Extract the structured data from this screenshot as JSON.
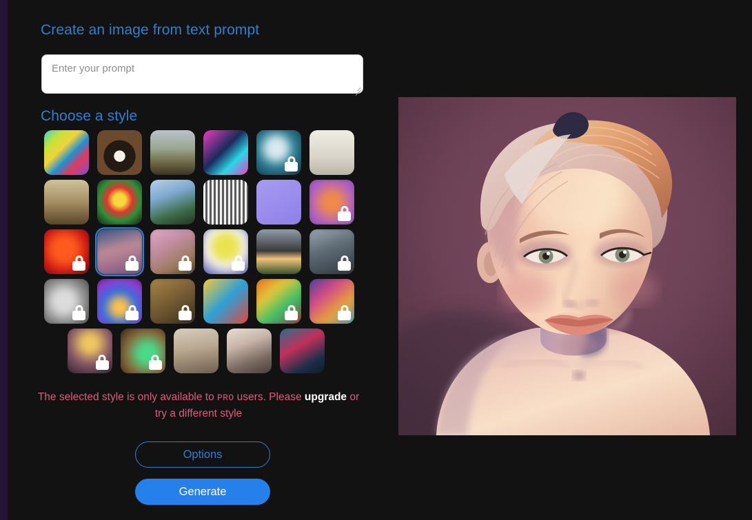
{
  "page": {
    "background": "#121212",
    "left_rail_color": "#251437",
    "accent": "#2f7fd1",
    "generate_color": "#2680eb",
    "error_color": "#e05a7e"
  },
  "headings": {
    "create": "Create an image from text prompt",
    "choose_style": "Choose a style"
  },
  "prompt": {
    "value": "",
    "placeholder": "Enter your prompt"
  },
  "error": {
    "part1": "The selected style is only available to ",
    "pro": "PRO",
    "part2": " users. Please ",
    "upgrade": "upgrade",
    "part3": " or try a different style"
  },
  "buttons": {
    "options": "Options",
    "generate": "Generate"
  },
  "style_grid": {
    "rows": [
      [
        {
          "name": "psychedelic-forest",
          "locked": false,
          "selected": false,
          "blurred": false
        },
        {
          "name": "panda-photoreal",
          "locked": false,
          "selected": false,
          "blurred": false
        },
        {
          "name": "misty-landscape",
          "locked": false,
          "selected": false,
          "blurred": false
        },
        {
          "name": "cyber-robot",
          "locked": false,
          "selected": false,
          "blurred": false
        },
        {
          "name": "neon-portrait",
          "locked": true,
          "selected": false,
          "blurred": true
        },
        {
          "name": "victorian-engraving",
          "locked": false,
          "selected": false,
          "blurred": false
        }
      ],
      [
        {
          "name": "renaissance-portrait",
          "locked": false,
          "selected": false,
          "blurred": false
        },
        {
          "name": "folk-flowers",
          "locked": false,
          "selected": false,
          "blurred": false
        },
        {
          "name": "impressionist-ballet",
          "locked": false,
          "selected": false,
          "blurred": false
        },
        {
          "name": "bw-etching-cup",
          "locked": false,
          "selected": false,
          "blurred": false
        },
        {
          "name": "isometric-retro-pc",
          "locked": false,
          "selected": false,
          "blurred": false
        },
        {
          "name": "fox-pastel",
          "locked": true,
          "selected": false,
          "blurred": true
        }
      ],
      [
        {
          "name": "red-glow-mask",
          "locked": true,
          "selected": false,
          "blurred": true
        },
        {
          "name": "dreamy-woman",
          "locked": true,
          "selected": true,
          "blurred": true
        },
        {
          "name": "pastel-abstract",
          "locked": true,
          "selected": false,
          "blurred": true
        },
        {
          "name": "pop-art-portrait",
          "locked": true,
          "selected": false,
          "blurred": true
        },
        {
          "name": "modern-architecture",
          "locked": false,
          "selected": false,
          "blurred": false
        },
        {
          "name": "grey-smoke",
          "locked": true,
          "selected": false,
          "blurred": true
        }
      ],
      [
        {
          "name": "grey-texture",
          "locked": true,
          "selected": false,
          "blurred": true
        },
        {
          "name": "neon-figure",
          "locked": true,
          "selected": false,
          "blurred": true
        },
        {
          "name": "sepia-abstract",
          "locked": true,
          "selected": false,
          "blurred": true
        },
        {
          "name": "flat-icon-grid",
          "locked": false,
          "selected": false,
          "blurred": false
        },
        {
          "name": "vivid-orange-swirl",
          "locked": true,
          "selected": false,
          "blurred": true
        },
        {
          "name": "rainbow-abstract",
          "locked": true,
          "selected": false,
          "blurred": true
        }
      ],
      [
        {
          "name": "golden-crown-figure",
          "locked": true,
          "selected": false,
          "blurred": true
        },
        {
          "name": "green-gold-abstract",
          "locked": true,
          "selected": false,
          "blurred": true
        },
        {
          "name": "classical-girl",
          "locked": false,
          "selected": false,
          "blurred": false
        },
        {
          "name": "painterly-soldier",
          "locked": false,
          "selected": false,
          "blurred": false
        },
        {
          "name": "teal-red-portrait",
          "locked": false,
          "selected": false,
          "blurred": false
        }
      ]
    ]
  },
  "preview": {
    "alt": "3D rendered portrait of a smiling blonde woman with an updo hairstyle on a mauve background",
    "background": "#6b4158"
  }
}
